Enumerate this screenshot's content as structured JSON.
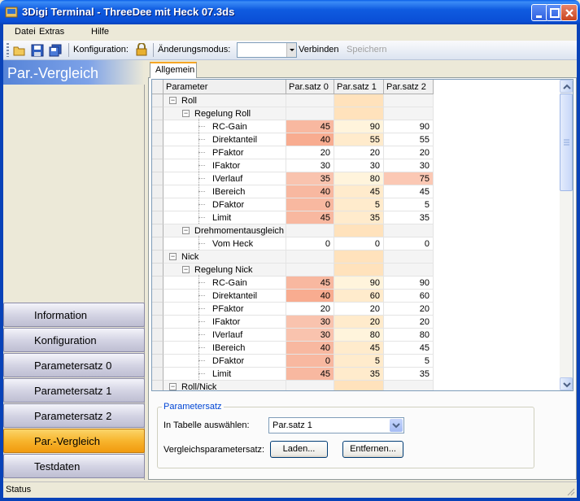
{
  "window": {
    "title": "3Digi Terminal - ThreeDee mit Heck 07.3ds"
  },
  "menu": [
    "Datei",
    "Extras",
    "Hilfe"
  ],
  "toolbar": {
    "konfiguration_label": "Konfiguration:",
    "aenderungsmodus_label": "Änderungsmodus:",
    "aenderungsmodus_value": "",
    "verbinden_label": "Verbinden",
    "speichern_label": "Speichern"
  },
  "sidebar": {
    "header": "Par.-Vergleich",
    "items": [
      {
        "label": "Information",
        "active": false
      },
      {
        "label": "Konfiguration",
        "active": false
      },
      {
        "label": "Parametersatz 0",
        "active": false
      },
      {
        "label": "Parametersatz 1",
        "active": false
      },
      {
        "label": "Parametersatz 2",
        "active": false
      },
      {
        "label": "Par.-Vergleich",
        "active": true
      },
      {
        "label": "Testdaten",
        "active": false
      }
    ]
  },
  "tabs": [
    {
      "label": "Allgemein"
    }
  ],
  "grid": {
    "columns": [
      "Parameter",
      "Par.satz 0",
      "Par.satz 1",
      "Par.satz 2"
    ],
    "rows": [
      {
        "level": 0,
        "name": "Roll",
        "group": true,
        "values": [
          "",
          "",
          ""
        ]
      },
      {
        "level": 1,
        "name": "Regelung Roll",
        "group": true,
        "values": [
          "",
          "",
          ""
        ]
      },
      {
        "level": 2,
        "name": "RC-Gain",
        "values": [
          "45",
          "90",
          "90"
        ],
        "colors": [
          "#F8B8A0",
          "#FFF4DC",
          "#FFFFFF"
        ]
      },
      {
        "level": 2,
        "name": "Direktanteil",
        "values": [
          "40",
          "55",
          "55"
        ],
        "colors": [
          "#F8AC90",
          "#FFEBCC",
          "#FFFFFF"
        ]
      },
      {
        "level": 2,
        "name": "PFaktor",
        "values": [
          "20",
          "20",
          "20"
        ],
        "colors": [
          "#FFFFFF",
          "#FFFFFF",
          "#FFFFFF"
        ]
      },
      {
        "level": 2,
        "name": "IFaktor",
        "values": [
          "30",
          "30",
          "30"
        ],
        "colors": [
          "#FFFFFF",
          "#FFFFFF",
          "#FFFFFF"
        ]
      },
      {
        "level": 2,
        "name": "IVerlauf",
        "values": [
          "35",
          "80",
          "75"
        ],
        "colors": [
          "#F9C3AE",
          "#FFF4DC",
          "#FBC8B4"
        ]
      },
      {
        "level": 2,
        "name": "IBereich",
        "values": [
          "40",
          "45",
          "45"
        ],
        "colors": [
          "#F8B8A0",
          "#FFEBCC",
          "#FFFFFF"
        ]
      },
      {
        "level": 2,
        "name": "DFaktor",
        "values": [
          "0",
          "5",
          "5"
        ],
        "colors": [
          "#F8B8A0",
          "#FFEBCC",
          "#FFFFFF"
        ]
      },
      {
        "level": 2,
        "name": "Limit",
        "values": [
          "45",
          "35",
          "35"
        ],
        "colors": [
          "#F8B8A0",
          "#FFEBCC",
          "#FFFFFF"
        ]
      },
      {
        "level": 1,
        "name": "Drehmomentausgleich",
        "group": true,
        "values": [
          "",
          "",
          ""
        ]
      },
      {
        "level": 2,
        "name": "Vom Heck",
        "values": [
          "0",
          "0",
          "0"
        ],
        "colors": [
          "#FFFFFF",
          "#FFFFFF",
          "#FFFFFF"
        ]
      },
      {
        "level": 0,
        "name": "Nick",
        "group": true,
        "values": [
          "",
          "",
          ""
        ]
      },
      {
        "level": 1,
        "name": "Regelung Nick",
        "group": true,
        "values": [
          "",
          "",
          ""
        ]
      },
      {
        "level": 2,
        "name": "RC-Gain",
        "values": [
          "45",
          "90",
          "90"
        ],
        "colors": [
          "#F8B8A0",
          "#FFF4DC",
          "#FFFFFF"
        ]
      },
      {
        "level": 2,
        "name": "Direktanteil",
        "values": [
          "40",
          "60",
          "60"
        ],
        "colors": [
          "#F8AC90",
          "#FFEBCC",
          "#FFFFFF"
        ]
      },
      {
        "level": 2,
        "name": "PFaktor",
        "values": [
          "20",
          "20",
          "20"
        ],
        "colors": [
          "#FFFFFF",
          "#FFFFFF",
          "#FFFFFF"
        ]
      },
      {
        "level": 2,
        "name": "IFaktor",
        "values": [
          "30",
          "20",
          "20"
        ],
        "colors": [
          "#F9C3AE",
          "#FFEBCC",
          "#FFFFFF"
        ]
      },
      {
        "level": 2,
        "name": "IVerlauf",
        "values": [
          "30",
          "80",
          "80"
        ],
        "colors": [
          "#F9C3AE",
          "#FFF4DC",
          "#FFFFFF"
        ]
      },
      {
        "level": 2,
        "name": "IBereich",
        "values": [
          "40",
          "45",
          "45"
        ],
        "colors": [
          "#F8B8A0",
          "#FFEBCC",
          "#FFFFFF"
        ]
      },
      {
        "level": 2,
        "name": "DFaktor",
        "values": [
          "0",
          "5",
          "5"
        ],
        "colors": [
          "#F8B8A0",
          "#FFEBCC",
          "#FFFFFF"
        ]
      },
      {
        "level": 2,
        "name": "Limit",
        "values": [
          "45",
          "35",
          "35"
        ],
        "colors": [
          "#F8B8A0",
          "#FFEBCC",
          "#FFFFFF"
        ]
      },
      {
        "level": 0,
        "name": "Roll/Nick",
        "group": true,
        "values": [
          "",
          "",
          ""
        ]
      }
    ]
  },
  "parametersatz": {
    "title": "Parametersatz",
    "select_label": "In Tabelle auswählen:",
    "select_value": "Par.satz 1",
    "compare_label": "Vergleichsparametersatz:",
    "laden_label": "Laden...",
    "entfernen_label": "Entfernen..."
  },
  "status": {
    "text": "Status"
  },
  "colors": {
    "accent": "#0A4FD6",
    "active_nav": "#F7B52E",
    "selected_column": "#FFE2BC"
  }
}
